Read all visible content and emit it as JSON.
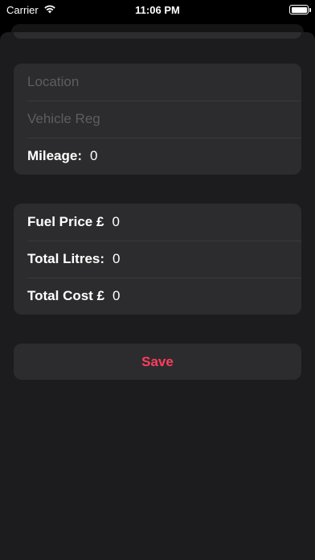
{
  "status_bar": {
    "carrier": "Carrier",
    "time": "11:06 PM"
  },
  "form": {
    "location_placeholder": "Location",
    "vehicle_reg_placeholder": "Vehicle Reg",
    "mileage_label": "Mileage:",
    "mileage_value": "0",
    "fuel_price_label": "Fuel Price £",
    "fuel_price_value": "0",
    "total_litres_label": "Total Litres:",
    "total_litres_value": "0",
    "total_cost_label": "Total Cost £",
    "total_cost_value": "0"
  },
  "actions": {
    "save_label": "Save"
  },
  "colors": {
    "accent": "#ff3d5e",
    "background": "#1c1c1e",
    "cell": "#2c2c2e"
  }
}
